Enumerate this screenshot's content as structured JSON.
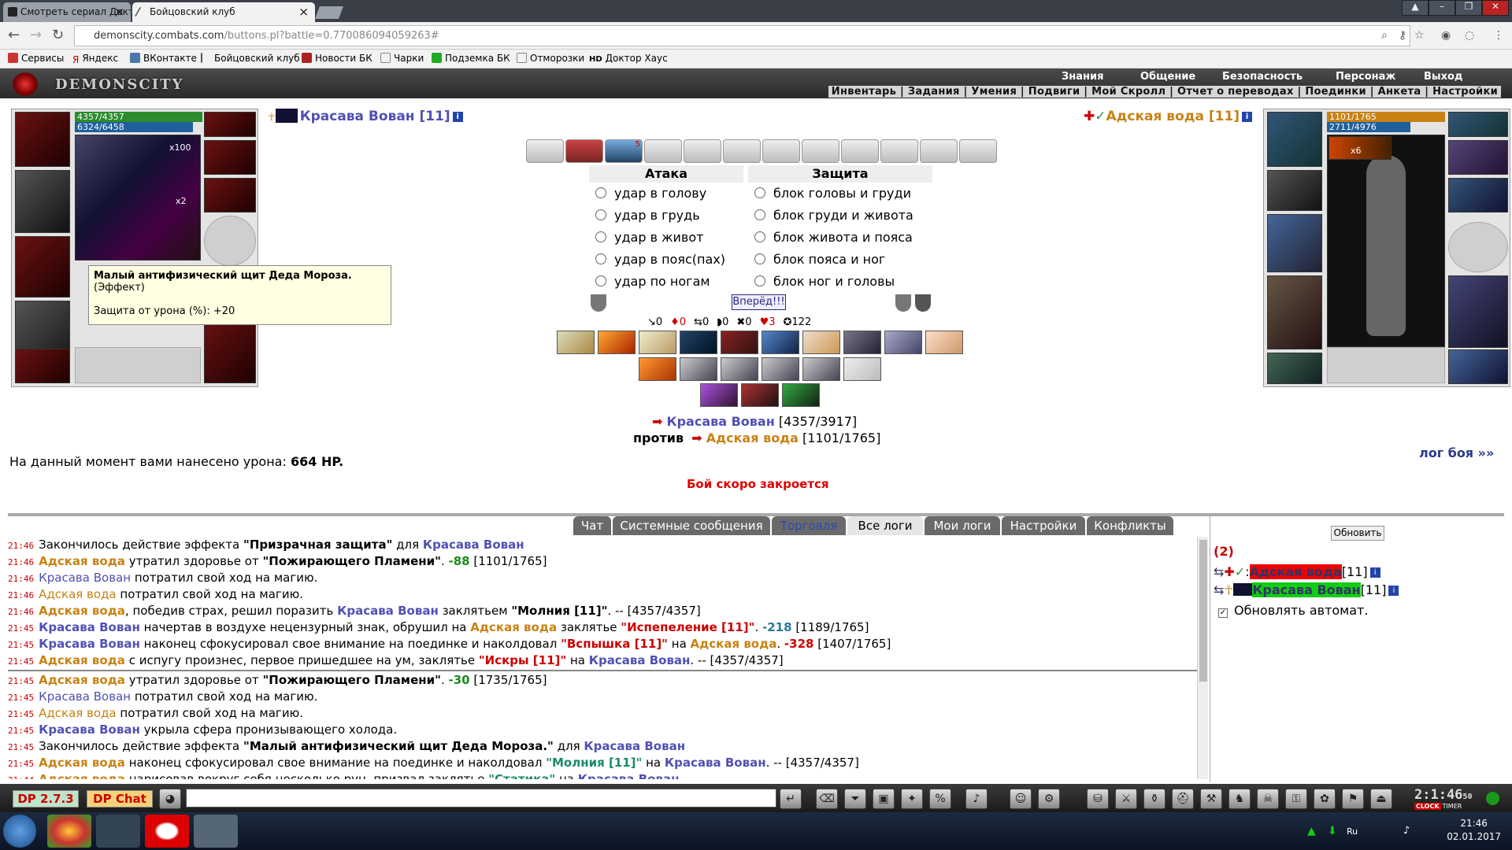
{
  "browser": {
    "tabs": [
      {
        "label": "Смотреть сериал Доктор",
        "active": false
      },
      {
        "label": "Бойцовский клуб",
        "active": true
      }
    ],
    "url_host": "demonscity.combats.com",
    "url_path": "/buttons.pl?battle=0.770086094059263#",
    "bookmarks": [
      "Сервисы",
      "Яндекс",
      "ВКонтакте",
      "Бойцовский клуб",
      "Новости БК",
      "Чарки",
      "Подземка БК",
      "Отморозки",
      "Доктор Хаус"
    ],
    "bookmark_hd": "HD"
  },
  "game": {
    "logo": "DEMONSCITY",
    "main_menu": [
      "Знания",
      "Общение",
      "Безопасность",
      "Персонаж",
      "Выход"
    ],
    "sub_menu": "Инвентарь | Задания | Умения | Подвиги | Мой Скролл | Отчет о переводах | Поединки | Анкета | Настройки"
  },
  "player": {
    "name": "Красава Вован [11]",
    "hp": "4357/4357",
    "mp": "6324/6458",
    "x100": "x100",
    "x2": "x2"
  },
  "enemy": {
    "name": "Адская вода [11]",
    "hp": "1101/1765",
    "mp": "2711/4976",
    "x6": "x6"
  },
  "tooltip": {
    "title": "Малый антифизический щит Деда Мороза.",
    "type": "(Эффект)",
    "stat": "Защита от урона (%): +20"
  },
  "scroll_badge": "5",
  "attack": {
    "header": "Атака",
    "options": [
      "удар в голову",
      "удар в грудь",
      "удар в живот",
      "удар в пояс(пах)",
      "удар по ногам"
    ]
  },
  "defense": {
    "header": "Защита",
    "options": [
      "блок головы и груди",
      "блок груди и живота",
      "блок живота и пояса",
      "блок пояса и ног",
      "блок ног и головы"
    ]
  },
  "go_button": "Вперёд!!!",
  "stats": [
    "↘0",
    "♦0",
    "⇆0",
    "◗0",
    "✖0",
    "♥3",
    "✪122"
  ],
  "vs": {
    "p1": "Красава Вован",
    "p1hp": "[4357/3917]",
    "against": "против",
    "p2": "Адская вода",
    "p2hp": "[1101/1765]"
  },
  "damage": {
    "text": "На данный момент вами нанесено урона:",
    "value": "664 HP."
  },
  "closing": "Бой скоро закроется",
  "log_link": "лог боя »»",
  "chat_tabs": [
    "Чат",
    "Системные сообщения",
    "Торговля",
    "Все логи",
    "Мои логи",
    "Настройки",
    "Конфликты"
  ],
  "log_lines": [
    [
      [
        "t",
        "21:46"
      ],
      [
        "n",
        "Закончилось действие эффекта "
      ],
      [
        "b",
        "\"Призрачная защита\""
      ],
      [
        "n",
        " для "
      ],
      [
        "bl",
        "Красава Вован"
      ]
    ],
    [
      [
        "t",
        "21:46"
      ],
      [
        "or",
        "Адская вода"
      ],
      [
        "n",
        " утратил здоровье от "
      ],
      [
        "b",
        "\"Пожирающего Пламени\""
      ],
      [
        "n",
        ". "
      ],
      [
        "gr",
        "-88"
      ],
      [
        "n",
        " [1101/1765]"
      ]
    ],
    [
      [
        "t",
        "21:46"
      ],
      [
        "blr",
        "Красава Вован"
      ],
      [
        "n",
        " потратил свой ход на магию."
      ]
    ],
    [
      [
        "t",
        "21:46"
      ],
      [
        "orr",
        "Адская вода"
      ],
      [
        "n",
        " потратил свой ход на магию."
      ]
    ],
    [
      [
        "t",
        "21:46"
      ],
      [
        "or",
        "Адская вода"
      ],
      [
        "n",
        ", победив страх, решил поразить "
      ],
      [
        "bl",
        "Красава Вован"
      ],
      [
        "n",
        " заклятьем "
      ],
      [
        "b",
        "\"Молния [11]\""
      ],
      [
        "n",
        ". -- [4357/4357]"
      ]
    ],
    [
      [
        "t",
        "21:45"
      ],
      [
        "bl",
        "Красава Вован"
      ],
      [
        "n",
        " начертав в воздухе нецензурный знак, обрушил на "
      ],
      [
        "or",
        "Адская вода"
      ],
      [
        "n",
        " заклятье "
      ],
      [
        "rd",
        "\"Испепеление [11]\""
      ],
      [
        "n",
        ". "
      ],
      [
        "tl",
        "-218"
      ],
      [
        "n",
        " [1189/1765]"
      ]
    ],
    [
      [
        "t",
        "21:45"
      ],
      [
        "bl",
        "Красава Вован"
      ],
      [
        "n",
        " наконец сфокусировал свое внимание на поединке и наколдовал "
      ],
      [
        "rd",
        "\"Вспышка [11]\""
      ],
      [
        "n",
        " на "
      ],
      [
        "or",
        "Адская вода"
      ],
      [
        "n",
        ". "
      ],
      [
        "rd",
        "-328"
      ],
      [
        "n",
        " [1407/1765]"
      ]
    ],
    [
      [
        "t",
        "21:45"
      ],
      [
        "or",
        "Адская вода"
      ],
      [
        "n",
        " с испугу произнес, первое пришедшее на ум, заклятье "
      ],
      [
        "rd",
        "\"Искры [11]\""
      ],
      [
        "n",
        " на "
      ],
      [
        "bl",
        "Красава Вован"
      ],
      [
        "n",
        ". -- [4357/4357]"
      ]
    ],
    [
      [
        "div",
        ""
      ]
    ],
    [
      [
        "t",
        "21:45"
      ],
      [
        "or",
        "Адская вода"
      ],
      [
        "n",
        " утратил здоровье от "
      ],
      [
        "b",
        "\"Пожирающего Пламени\""
      ],
      [
        "n",
        ". "
      ],
      [
        "gr",
        "-30"
      ],
      [
        "n",
        " [1735/1765]"
      ]
    ],
    [
      [
        "t",
        "21:45"
      ],
      [
        "blr",
        "Красава Вован"
      ],
      [
        "n",
        " потратил свой ход на магию."
      ]
    ],
    [
      [
        "t",
        "21:45"
      ],
      [
        "orr",
        "Адская вода"
      ],
      [
        "n",
        " потратил свой ход на магию."
      ]
    ],
    [
      [
        "t",
        "21:45"
      ],
      [
        "bl",
        "Красава Вован"
      ],
      [
        "n",
        " укрыла сфера пронизывающего холода."
      ]
    ],
    [
      [
        "t",
        "21:45"
      ],
      [
        "n",
        "Закончилось действие эффекта "
      ],
      [
        "b",
        "\"Малый антифизический щит Деда Мороза.\""
      ],
      [
        "n",
        " для "
      ],
      [
        "bl",
        "Красава Вован"
      ]
    ],
    [
      [
        "t",
        "21:45"
      ],
      [
        "or",
        "Адская вода"
      ],
      [
        "n",
        " наконец сфокусировал свое внимание на поединке и наколдовал "
      ],
      [
        "tlb",
        "\"Молния [11]\""
      ],
      [
        "n",
        " на "
      ],
      [
        "bl",
        "Красава Вован"
      ],
      [
        "n",
        ". -- [4357/4357]"
      ]
    ],
    [
      [
        "t",
        "21:44"
      ],
      [
        "or",
        "Адская вода"
      ],
      [
        "n",
        " нарисовав вокруг себя несколько рун, призвал заклятье "
      ],
      [
        "tlb",
        "\"Статика\""
      ],
      [
        "n",
        " на "
      ],
      [
        "bl",
        "Красава Вован"
      ],
      [
        "n",
        "."
      ]
    ]
  ],
  "right": {
    "update": "Обновить",
    "count": "(2)",
    "p1": "Адская вода",
    "p2": "Красава Вован",
    "lvl": "[11]",
    "auto": "Обновлять автомат."
  },
  "bottom": {
    "dp_version": "DP 2.7.3",
    "dp_chat": "DP Chat",
    "clock": "2:1:46",
    "clock_sec": "50",
    "clock_label": "CLOCK",
    "timer_label": "TIMER"
  },
  "taskbar": {
    "time": "21:46",
    "date": "02.01.2017",
    "lang": "Ru"
  },
  "colors": {
    "blue": "#5050b4",
    "orange": "#c88214",
    "red": "#e00000"
  }
}
